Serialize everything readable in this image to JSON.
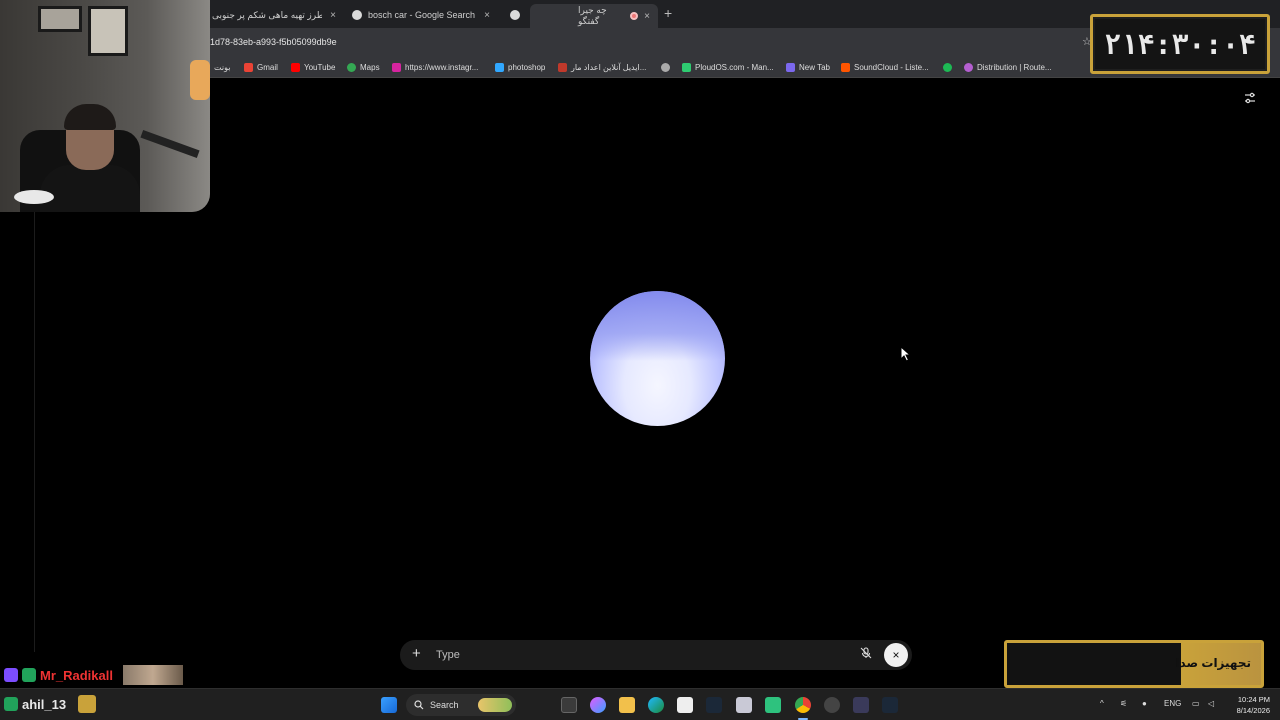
{
  "browser": {
    "tabs": [
      {
        "label": "طرز تهیه ماهی شکم پر جنوبی",
        "active": false
      },
      {
        "label": "bosch car - Google Search",
        "active": false
      },
      {
        "label": "",
        "active": false
      },
      {
        "label": "چه جیرا گفتگو",
        "active": true
      }
    ],
    "url": "1d78-83eb-a993-f5b05099db9e",
    "bookmarks": [
      {
        "label": "بونت",
        "color": "#888888"
      },
      {
        "label": "Gmail",
        "color": "#ea4335"
      },
      {
        "label": "YouTube",
        "color": "#ff0000"
      },
      {
        "label": "Maps",
        "color": "#34a853"
      },
      {
        "label": "https://www.instagr...",
        "color": "#d6249f"
      },
      {
        "label": "photoshop",
        "color": "#31a8ff"
      },
      {
        "label": "ایدیل آنلاین اعداد مار...",
        "color": "#c0392b"
      },
      {
        "label": "",
        "color": "#aaaaaa"
      },
      {
        "label": "PloudOS.com - Man...",
        "color": "#2ecc71"
      },
      {
        "label": "New Tab",
        "color": "#7b68ee"
      },
      {
        "label": "SoundCloud - Liste...",
        "color": "#ff5500"
      },
      {
        "label": "",
        "color": "#1db954"
      },
      {
        "label": "Distribution | Route...",
        "color": "#b45fd0"
      }
    ]
  },
  "timer": {
    "text": "۲۱۴:۳۰:۰۴",
    "border_color": "#c9a23a"
  },
  "input": {
    "placeholder": "Type",
    "close_symbol": "×",
    "plus_symbol": "+"
  },
  "sponsor": {
    "text": "تجهیزات صدا"
  },
  "chat": {
    "user1": "Mr_Radikall",
    "user2": "ahil_13"
  },
  "taskbar": {
    "search_label": "Search",
    "language": "ENG",
    "time": "10:24 PM",
    "date": "8/14/2026"
  },
  "colors": {
    "accent_gold": "#c9a23a",
    "orb": "#bfc5ff"
  }
}
